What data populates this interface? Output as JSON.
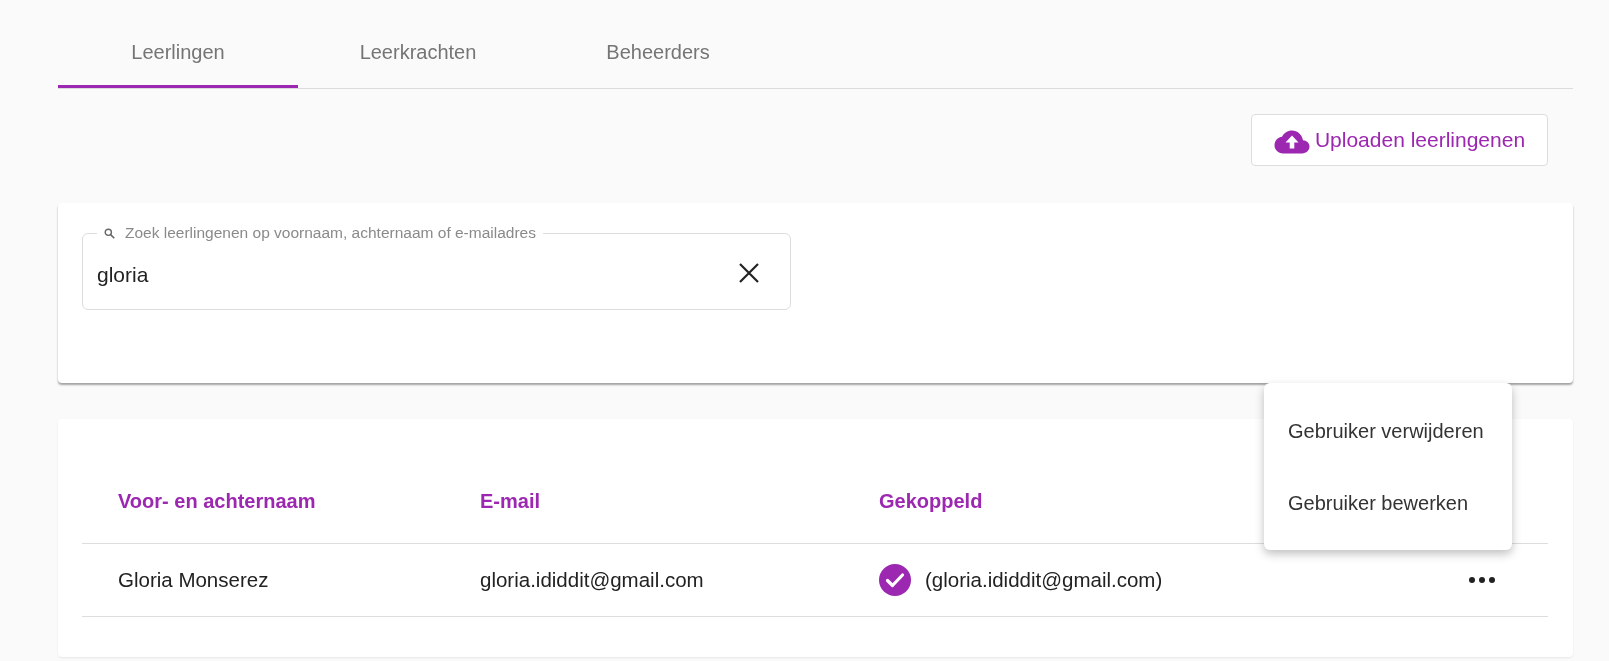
{
  "tabs": [
    {
      "label": "Leerlingen",
      "selected": true
    },
    {
      "label": "Leerkrachten",
      "selected": false
    },
    {
      "label": "Beheerders",
      "selected": false
    }
  ],
  "upload_button": {
    "label": "Uploaden leerlingenen"
  },
  "search": {
    "label": "Zoek leerlingenen op voornaam, achternaam of e-mailadres",
    "value": "gloria"
  },
  "table": {
    "columns": [
      "Voor- en achternaam",
      "E-mail",
      "Gekoppeld"
    ],
    "rows": [
      {
        "name": "Gloria Monserez",
        "email": "gloria.ididdit@gmail.com",
        "linked": true,
        "linked_account": "(gloria.ididdit@gmail.com)"
      }
    ]
  },
  "context_menu": {
    "items": [
      "Gebruiker verwijderen",
      "Gebruiker bewerken"
    ]
  }
}
